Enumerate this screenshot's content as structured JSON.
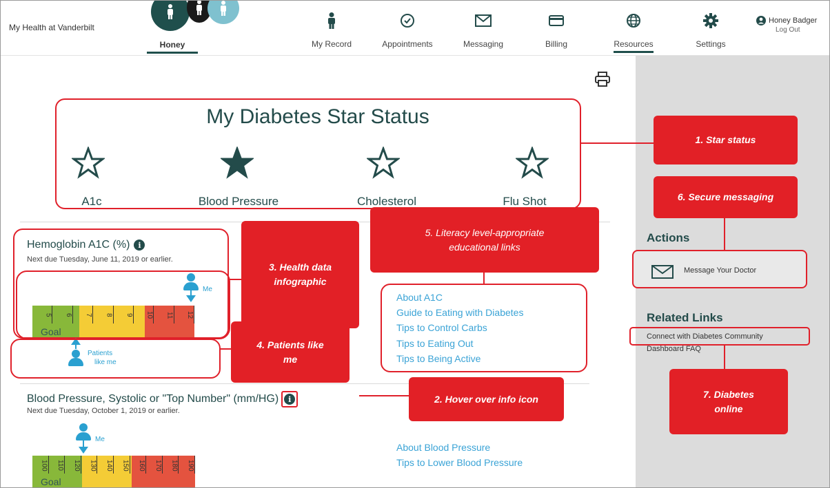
{
  "header": {
    "app_title": "My Health at Vanderbilt",
    "profile_tab": "Honey",
    "nav": [
      {
        "label": "My Record",
        "icon": "person-icon"
      },
      {
        "label": "Appointments",
        "icon": "clock-icon"
      },
      {
        "label": "Messaging",
        "icon": "envelope-icon"
      },
      {
        "label": "Billing",
        "icon": "card-icon"
      },
      {
        "label": "Resources",
        "icon": "globe-icon",
        "active": true
      },
      {
        "label": "Settings",
        "icon": "gear-icon"
      }
    ],
    "user_name": "Honey Badger",
    "logout": "Log Out"
  },
  "star_status": {
    "title": "My Diabetes Star Status",
    "items": [
      {
        "label": "A1c",
        "filled": false
      },
      {
        "label": "Blood Pressure",
        "filled": true
      },
      {
        "label": "Cholesterol",
        "filled": false
      },
      {
        "label": "Flu Shot",
        "filled": false
      }
    ]
  },
  "a1c": {
    "title": "Hemoglobin A1C (%)",
    "next_due": "Next due Tuesday, June 11, 2019 or earlier.",
    "ticks": [
      "5",
      "6",
      "7",
      "8",
      "9",
      "10",
      "11",
      "12"
    ],
    "goal_label": "Goal",
    "me_label": "Me",
    "patients_label_1": "Patients",
    "patients_label_2": "like me",
    "links": [
      "About A1C",
      "Guide to Eating with Diabetes",
      "Tips to Control Carbs",
      "Tips to Eating Out",
      "Tips to Being Active"
    ]
  },
  "bp": {
    "title": "Blood Pressure, Systolic or \"Top Number\" (mm/HG)",
    "next_due": "Next due Tuesday, October 1, 2019 or earlier.",
    "ticks": [
      "100",
      "110",
      "120",
      "130",
      "140",
      "150",
      "160",
      "170",
      "180",
      "190"
    ],
    "goal_label": "Goal",
    "me_label": "Me",
    "links": [
      "About Blood Pressure",
      "Tips to Lower Blood Pressure"
    ]
  },
  "sidebar": {
    "actions_heading": "Actions",
    "message_doctor": "Message Your Doctor",
    "related_heading": "Related Links",
    "related_links": [
      "Connect with Diabetes Community",
      "Dashboard FAQ"
    ]
  },
  "callouts": {
    "c1": "1. Star status",
    "c2": "2. Hover over info icon",
    "c3a": "3. Health data",
    "c3b": "infographic",
    "c4a": "4. Patients like",
    "c4b": "me",
    "c5a": "5. Literacy level-appropriate",
    "c5b": "educational links",
    "c6": "6. Secure messaging",
    "c7a": "7. Diabetes",
    "c7b": "online"
  },
  "colors": {
    "accent": "#1f4f4c",
    "callout": "#e22026",
    "link": "#3aa3d6",
    "scale_green": "#88b83a",
    "scale_yellow": "#f4cc36",
    "scale_red": "#e4533f"
  }
}
